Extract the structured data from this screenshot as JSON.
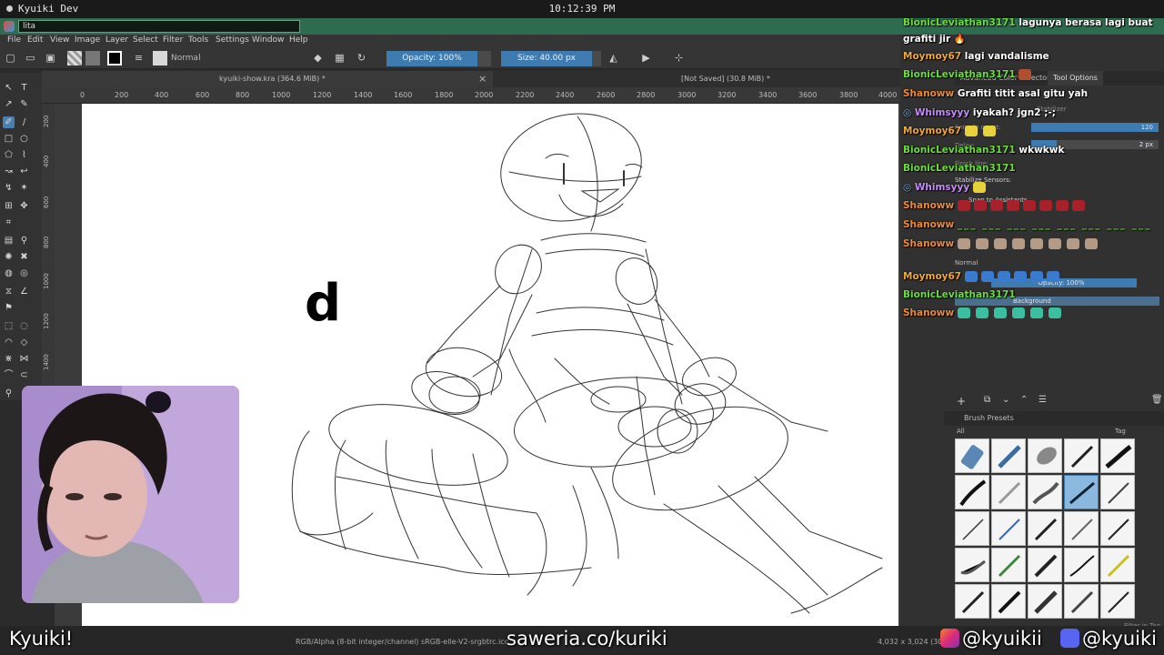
{
  "os": {
    "title": "Kyuiki Dev",
    "clock": "10:12:39 PM"
  },
  "krita": {
    "search_value": "lita",
    "menu": [
      "File",
      "Edit",
      "View",
      "Image",
      "Layer",
      "Select",
      "Filter",
      "Tools",
      "Settings",
      "Window",
      "Help"
    ],
    "blend_mode": "Normal",
    "opacity_label": "Opacity: 100%",
    "size_label": "Size: 40.00 px",
    "tabs": [
      {
        "label": "kyuiki-show.kra (364.6 MiB) *",
        "active": true
      },
      {
        "label": "[Not Saved] (30.8 MiB) *",
        "active": false
      }
    ],
    "ruler_ticks": [
      "0",
      "200",
      "400",
      "600",
      "800",
      "1000",
      "1200",
      "1400",
      "1600",
      "1800",
      "2000",
      "2200",
      "2400",
      "2600",
      "2800",
      "3000",
      "3200",
      "3400",
      "3600",
      "3800",
      "4000"
    ],
    "vruler_ticks": [
      "200",
      "400",
      "600",
      "800",
      "1000",
      "1200",
      "1400"
    ],
    "canvas_letter": "d",
    "status_color": "RGB/Alpha (8-bit integer/channel)  sRGB-elle-V2-srgbtrc.icc",
    "status_dims": "4,032 x 3,024 (30..."
  },
  "dock": {
    "tool_options_tabs": [
      "Advanced Color Selector",
      "Tool Options"
    ],
    "stabilizer_label": "Stabilizer",
    "sample_count_label": "Sample count:",
    "sample_count_value": "120",
    "delay_label": "Delay:",
    "delay_value": "2 px",
    "finish_line_label": "Finish line:",
    "stabilize_sensors_label": "Stabilize Sensors:",
    "snap_label": "Snap to Assistants",
    "layer_blend": "Normal",
    "layer_opacity": "Opacity: 100%",
    "layer_name": "Background",
    "brush_presets_title": "Brush Presets",
    "brush_filter": "All",
    "brush_tag_label": "Tag",
    "filter_in_tag": "Filter in Tag"
  },
  "chat": [
    {
      "user": "BionicLeviathan3171",
      "color": "#6bde3b",
      "text": "lagunya berasa lagi buat"
    },
    {
      "user": "",
      "color": "#ffffff",
      "text": "grafiti jir 🔥"
    },
    {
      "user": "Moymoy67",
      "color": "#f0a830",
      "text": "lagi vandalisme"
    },
    {
      "user": "BionicLeviathan3171",
      "color": "#6bde3b",
      "text": ""
    },
    {
      "user": "Shanoww",
      "color": "#f08a30",
      "text": "Grafiti titit asal gitu yah"
    },
    {
      "user": "Whimsyyy",
      "color": "#c58cf5",
      "text": "iyakah? jgn2 ;-;"
    },
    {
      "user": "Moymoy67",
      "color": "#f0a830",
      "text": ""
    },
    {
      "user": "BionicLeviathan3171",
      "color": "#6bde3b",
      "text": "wkwkwk"
    },
    {
      "user": "BionicLeviathan3171",
      "color": "#6bde3b",
      "text": ""
    },
    {
      "user": "Whimsyyy",
      "color": "#c58cf5",
      "text": ""
    },
    {
      "user": "Shanoww",
      "color": "#f08a30",
      "text": ""
    },
    {
      "user": "Shanoww",
      "color": "#f08a30",
      "text": ""
    },
    {
      "user": "Shanoww",
      "color": "#f08a30",
      "text": ""
    },
    {
      "user": "Moymoy67",
      "color": "#f0a830",
      "text": ""
    },
    {
      "user": "BionicLeviathan3171",
      "color": "#6bde3b",
      "text": ""
    },
    {
      "user": "Shanoww",
      "color": "#f08a30",
      "text": ""
    }
  ],
  "overlay": {
    "streamer_name": "Kyuiki!",
    "donation_link": "saweria.co/kuriki",
    "instagram_handle": "@kyuikii",
    "discord_handle": "@kyuiki"
  }
}
